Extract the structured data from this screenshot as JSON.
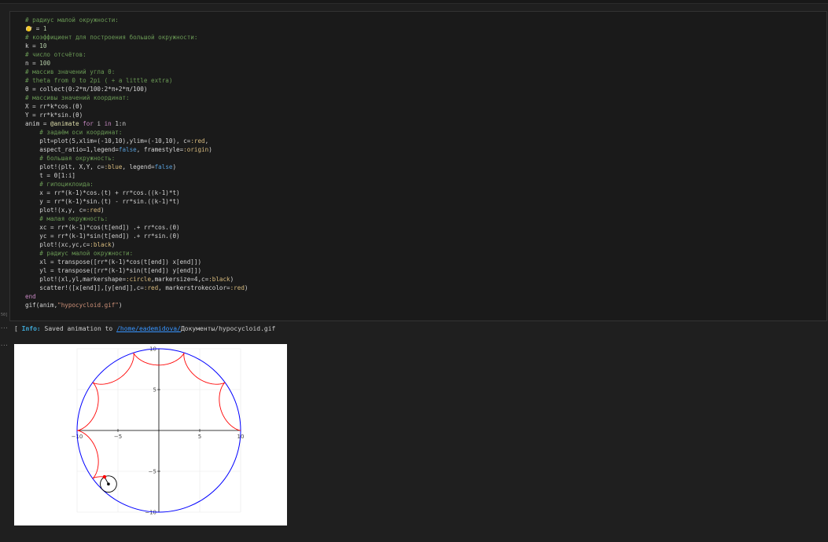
{
  "editor": {
    "exec_count": "50]",
    "code_lines": [
      [
        {
          "t": "# радиус малой окружности:",
          "c": "c"
        }
      ],
      [
        {
          "t": "rr = ",
          "c": ""
        },
        {
          "t": "1",
          "c": "n"
        }
      ],
      [
        {
          "t": "# коэффициент для построения большой окружности:",
          "c": "c"
        }
      ],
      [
        {
          "t": "k = ",
          "c": ""
        },
        {
          "t": "10",
          "c": "n"
        }
      ],
      [
        {
          "t": "# число отсчётов:",
          "c": "c"
        }
      ],
      [
        {
          "t": "n = ",
          "c": ""
        },
        {
          "t": "100",
          "c": "n"
        }
      ],
      [
        {
          "t": "# массив значений угла θ:",
          "c": "c"
        }
      ],
      [
        {
          "t": "# theta from 0 to 2pi ( + a little extra)",
          "c": "c"
        }
      ],
      [
        {
          "t": "θ = collect(0:2*π/100:2*π+2*π/100)",
          "c": ""
        }
      ],
      [
        {
          "t": "# массивы значений координат:",
          "c": "c"
        }
      ],
      [
        {
          "t": "X = rr*k*cos.(θ)",
          "c": ""
        }
      ],
      [
        {
          "t": "Y = rr*k*sin.(θ)",
          "c": ""
        }
      ],
      [
        {
          "t": "anim = ",
          "c": ""
        },
        {
          "t": "@animate",
          "c": "f"
        },
        {
          "t": " for",
          "c": "k"
        },
        {
          "t": " i ",
          "c": ""
        },
        {
          "t": "in",
          "c": "k"
        },
        {
          "t": " 1:n",
          "c": ""
        }
      ],
      [
        {
          "t": "    # задаём оси координат:",
          "c": "c"
        }
      ],
      [
        {
          "t": "    plt=plot(5,xlim=(-10,10),ylim=(-10,10), c=",
          "c": ""
        },
        {
          "t": ":red",
          "c": "sym"
        },
        {
          "t": ",",
          "c": ""
        }
      ],
      [
        {
          "t": "    aspect_ratio=1,legend=",
          "c": ""
        },
        {
          "t": "false",
          "c": "b"
        },
        {
          "t": ", framestyle=",
          "c": ""
        },
        {
          "t": ":origin",
          "c": "sym"
        },
        {
          "t": ")",
          "c": ""
        }
      ],
      [
        {
          "t": "    # большая окружность:",
          "c": "c"
        }
      ],
      [
        {
          "t": "    plot!(plt, X,Y, c=",
          "c": ""
        },
        {
          "t": ":blue",
          "c": "sym"
        },
        {
          "t": ", legend=",
          "c": ""
        },
        {
          "t": "false",
          "c": "b"
        },
        {
          "t": ")",
          "c": ""
        }
      ],
      [
        {
          "t": "    t = θ[1:i]",
          "c": ""
        }
      ],
      [
        {
          "t": "    # гипоциклоида:",
          "c": "c"
        }
      ],
      [
        {
          "t": "    x = rr*(k-1)*cos.(t) + rr*cos.((k-1)*t)",
          "c": ""
        }
      ],
      [
        {
          "t": "    y = rr*(k-1)*sin.(t) - rr*sin.((k-1)*t)",
          "c": ""
        }
      ],
      [
        {
          "t": "    plot!(x,y, c=",
          "c": ""
        },
        {
          "t": ":red",
          "c": "sym"
        },
        {
          "t": ")",
          "c": ""
        }
      ],
      [
        {
          "t": "    # малая окружность:",
          "c": "c"
        }
      ],
      [
        {
          "t": "    xc = rr*(k-1)*cos(t[end]) .+ rr*cos.(θ)",
          "c": ""
        }
      ],
      [
        {
          "t": "    yc = rr*(k-1)*sin(t[end]) .+ rr*sin.(θ)",
          "c": ""
        }
      ],
      [
        {
          "t": "    plot!(xc,yc,c=",
          "c": ""
        },
        {
          "t": ":black",
          "c": "sym"
        },
        {
          "t": ")",
          "c": ""
        }
      ],
      [
        {
          "t": "    # радиус малой окружности:",
          "c": "c"
        }
      ],
      [
        {
          "t": "    xl = transpose([rr*(k-1)*cos(t[end]) x[end]])",
          "c": ""
        }
      ],
      [
        {
          "t": "    yl = transpose([rr*(k-1)*sin(t[end]) y[end]])",
          "c": ""
        }
      ],
      [
        {
          "t": "    plot!(xl,yl,markershape=",
          "c": ""
        },
        {
          "t": ":circle",
          "c": "sym"
        },
        {
          "t": ",markersize=4,c=",
          "c": ""
        },
        {
          "t": ":black",
          "c": "sym"
        },
        {
          "t": ")",
          "c": ""
        }
      ],
      [
        {
          "t": "    scatter!([x[end]],[y[end]],c=",
          "c": ""
        },
        {
          "t": ":red",
          "c": "sym"
        },
        {
          "t": ", markerstrokecolor=",
          "c": ""
        },
        {
          "t": ":red",
          "c": "sym"
        },
        {
          "t": ")",
          "c": ""
        }
      ],
      [
        {
          "t": "end",
          "c": "k"
        }
      ],
      [
        {
          "t": "gif(anim,",
          "c": ""
        },
        {
          "t": "\"hypocycloid.gif\"",
          "c": "s"
        },
        {
          "t": ")",
          "c": ""
        }
      ]
    ]
  },
  "output": {
    "prefix": "[ ",
    "info_label": "Info:",
    "message": " Saved animation to ",
    "path_link": "/home/eademidova/",
    "path_rest": "Документы/hypocycloid.gif"
  },
  "chart_data": {
    "type": "line",
    "title": "",
    "xlim": [
      -10,
      10
    ],
    "ylim": [
      -10,
      10
    ],
    "xticks": [
      "−10",
      "−5",
      "5",
      "10"
    ],
    "yticks": [
      "10",
      "5",
      "−5",
      "−10"
    ],
    "grid": true,
    "legend": "none",
    "series": [
      {
        "role": "big-circle",
        "color": "#0000ff",
        "R": 10
      },
      {
        "role": "hypocycloid",
        "color": "#ff0000",
        "k": 10,
        "r": 1,
        "theta_end_fraction": 0.63
      },
      {
        "role": "small-circle",
        "color": "#000000",
        "r": 1
      },
      {
        "role": "radius-segment",
        "color": "#000000"
      },
      {
        "role": "tracer-point",
        "color": "#ff0000"
      }
    ]
  }
}
